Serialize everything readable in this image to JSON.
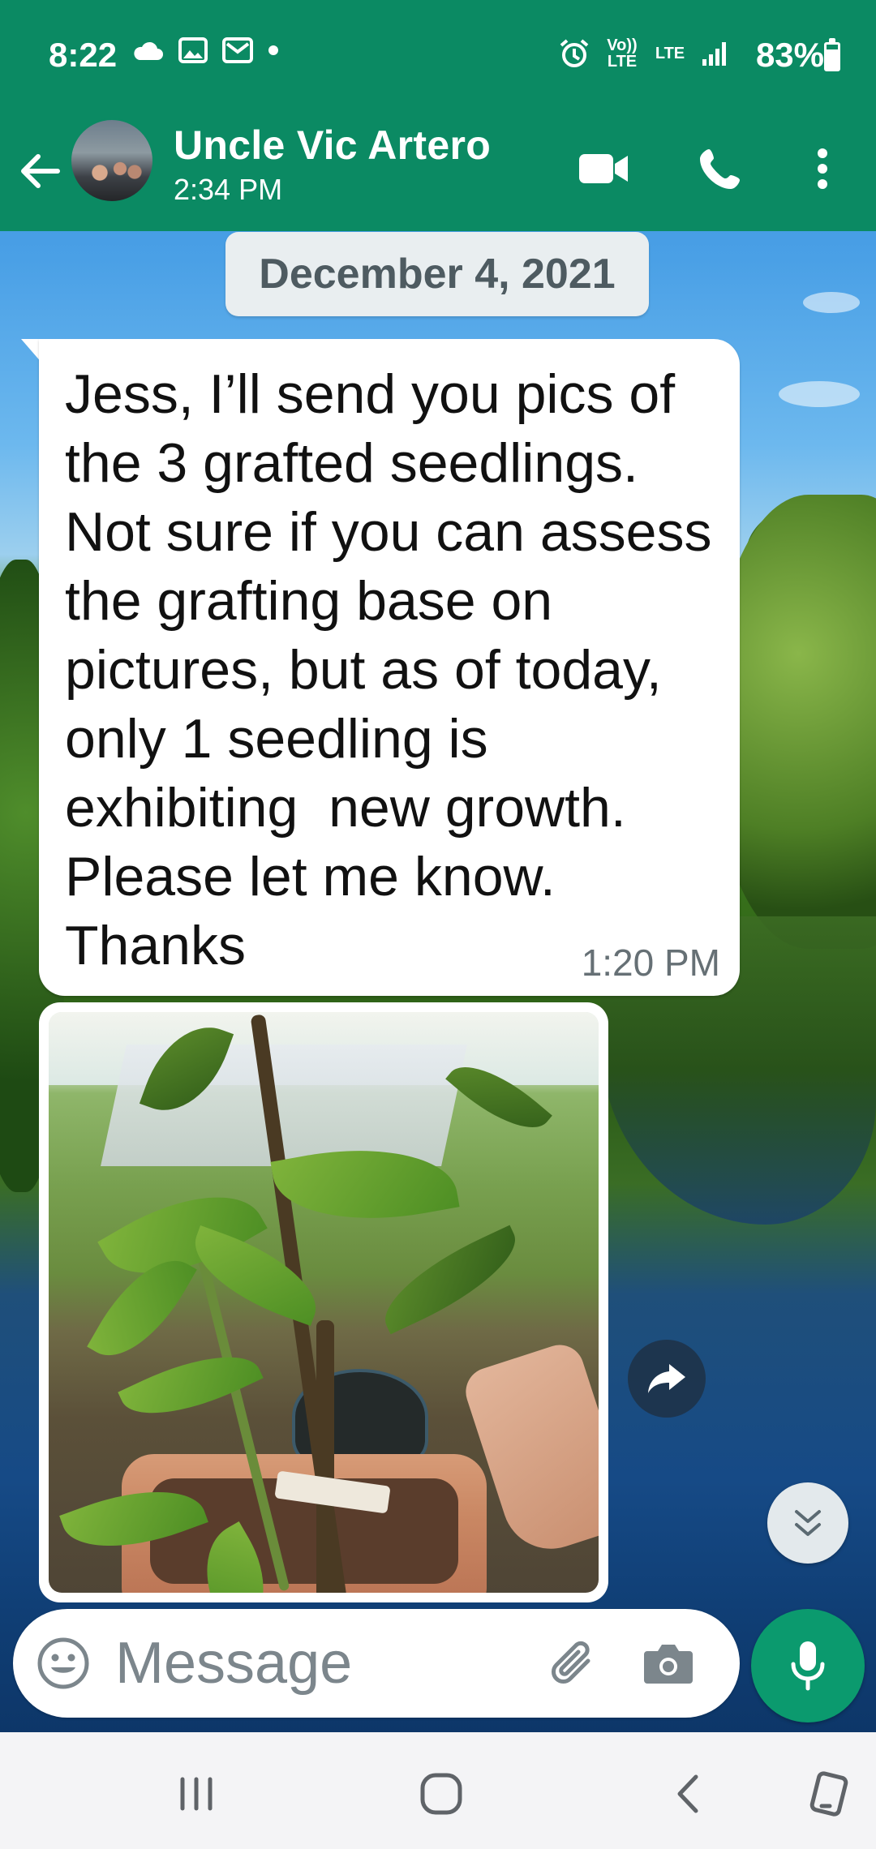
{
  "status_bar": {
    "time": "8:22",
    "battery": "83%",
    "volte_label": "Vo)) LTE",
    "lte_label": "LTE",
    "icons_left": [
      "cloud-icon",
      "image-icon",
      "mail-icon",
      "dot-icon"
    ],
    "icons_right": [
      "alarm-icon",
      "volte-icon",
      "lte-icon",
      "signal-icon"
    ]
  },
  "header": {
    "contact_name": "Uncle Vic Artero",
    "subtitle": "2:34 PM",
    "icons": [
      "back-arrow-icon",
      "video-call-icon",
      "phone-icon",
      "more-options-icon"
    ]
  },
  "chat": {
    "date_chip": "December 4, 2021",
    "message": {
      "text": "Jess, I’ll send you pics of the 3 grafted seedlings. Not sure if you can assess the grafting base on pictures, but as of today, only 1 seedling is exhibiting  new growth. Please let me know. Thanks",
      "time": "1:20 PM"
    },
    "photo_message": {
      "icon": "forward-icon"
    },
    "scroll_button_icon": "double-chevron-down-icon"
  },
  "composer": {
    "placeholder": "Message",
    "value": "",
    "icons": [
      "emoji-icon",
      "attach-icon",
      "camera-icon",
      "mic-icon"
    ]
  },
  "nav_bar": {
    "icons": [
      "recent-apps-icon",
      "home-icon",
      "back-icon",
      "rotate-icon"
    ]
  },
  "colors": {
    "header_green": "#0b8a63",
    "mic_green": "#0b9a6e",
    "bubble_white": "#ffffff",
    "date_chip": "#e9eef0"
  }
}
